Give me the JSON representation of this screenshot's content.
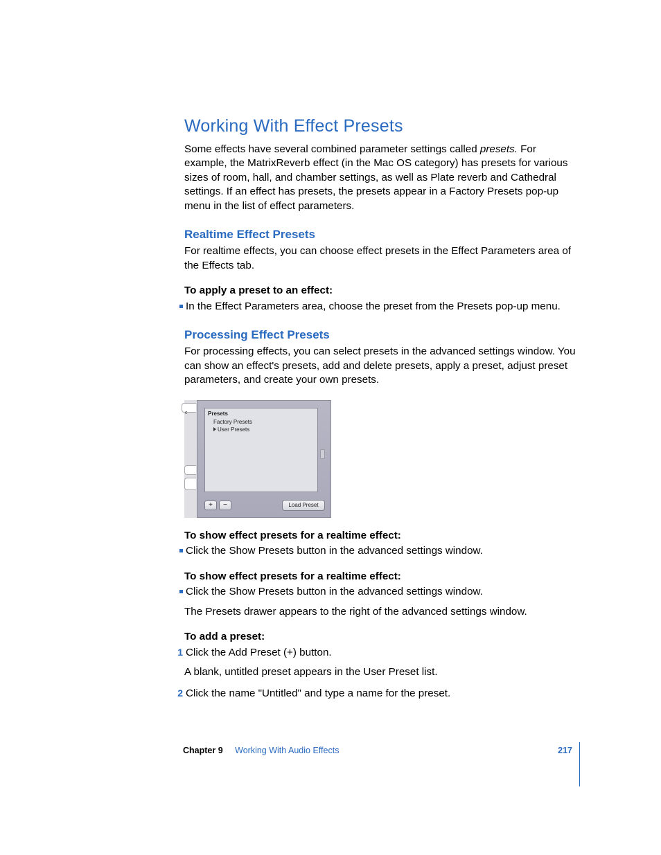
{
  "title": "Working With Effect Presets",
  "intro": {
    "pre": "Some effects have several combined parameter settings called ",
    "em": "presets.",
    "post": " For example, the MatrixReverb effect (in the Mac OS category) has presets for various sizes of room, hall, and chamber settings, as well as Plate reverb and Cathedral settings. If an effect has presets, the presets appear in a Factory Presets pop-up menu in the list of effect parameters."
  },
  "realtime": {
    "heading": "Realtime Effect Presets",
    "body": "For realtime effects, you can choose effect presets in the Effect Parameters area of the Effects tab.",
    "apply_heading": "To apply a preset to an effect:",
    "apply_bullet": "In the Effect Parameters area, choose the preset from the Presets pop-up menu."
  },
  "processing": {
    "heading": "Processing Effect Presets",
    "body": "For processing effects, you can select presets in the advanced settings window. You can show an effect's presets, add and delete presets, apply a preset, adjust preset parameters, and create your own presets."
  },
  "widget": {
    "left_tab_label": "c",
    "header": "Presets",
    "items": [
      "Factory Presets",
      "User Presets"
    ],
    "add_label": "+",
    "remove_label": "−",
    "load_label": "Load Preset"
  },
  "show1": {
    "heading": "To show effect presets for a realtime effect:",
    "bullet": "Click the Show Presets button in the advanced settings window."
  },
  "show2": {
    "heading": "To show effect presets for a realtime effect:",
    "bullet": "Click the Show Presets button in the advanced settings window.",
    "followup": "The Presets drawer appears to the right of the advanced settings window."
  },
  "add": {
    "heading": "To add a preset:",
    "steps": [
      "Click the Add Preset (+) button.",
      "Click the name \"Untitled\" and type a name for the preset."
    ],
    "followup": "A blank, untitled preset appears in the User Preset list."
  },
  "footer": {
    "chapter": "Chapter 9",
    "chapter_title": "Working With Audio Effects",
    "page": "217"
  }
}
